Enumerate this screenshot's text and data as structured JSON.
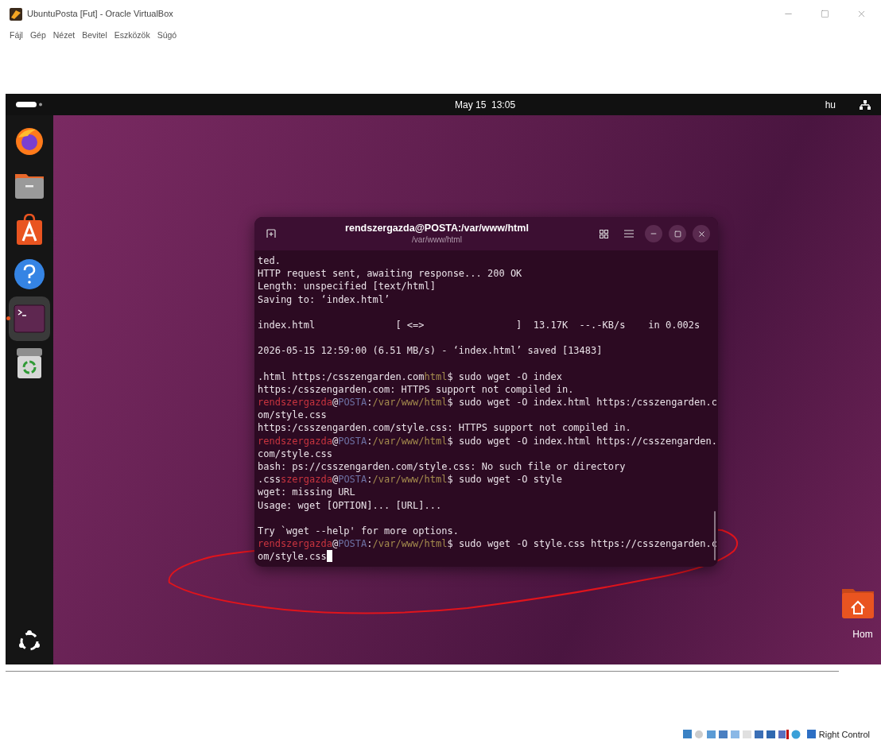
{
  "host_window": {
    "title": "UbuntuPosta [Fut] - Oracle VirtualBox",
    "menu": [
      "Fájl",
      "Gép",
      "Nézet",
      "Bevitel",
      "Eszközök",
      "Súgó"
    ]
  },
  "top_bar": {
    "clock": "May 15  13:05",
    "input_source": "hu"
  },
  "dock": {
    "items": [
      {
        "kind": "browser",
        "selected": false,
        "running": false
      },
      {
        "kind": "files",
        "selected": false,
        "running": false
      },
      {
        "kind": "store",
        "selected": false,
        "running": false
      },
      {
        "kind": "help",
        "selected": false,
        "running": false
      },
      {
        "kind": "terminal",
        "selected": true,
        "running": true
      },
      {
        "kind": "trash",
        "selected": false,
        "running": false
      }
    ]
  },
  "terminal": {
    "title": "rendszergazda@POSTA:/var/www/html",
    "subtitle": "/var/www/html",
    "cursor_visible": true,
    "lines": [
      {
        "kind": "output",
        "segments": [
          {
            "kind": "text",
            "text": "ted."
          }
        ]
      },
      {
        "kind": "output",
        "segments": [
          {
            "kind": "text",
            "text": "HTTP request sent, awaiting response... 200 OK"
          }
        ]
      },
      {
        "kind": "output",
        "segments": [
          {
            "kind": "text",
            "text": "Length: unspecified [text/html]"
          }
        ]
      },
      {
        "kind": "output",
        "segments": [
          {
            "kind": "text",
            "text": "Saving to: ‘index.html’"
          }
        ]
      },
      {
        "kind": "blank"
      },
      {
        "kind": "output",
        "segments": [
          {
            "kind": "text",
            "text": "index.html              [ <=>                ]  13.17K  --.-KB/s    in 0.002s"
          }
        ]
      },
      {
        "kind": "blank"
      },
      {
        "kind": "output",
        "segments": [
          {
            "kind": "text",
            "text": "2026-05-15 12:59:00 (6.51 MB/s) - ‘index.html’ saved [13483]"
          }
        ]
      },
      {
        "kind": "blank"
      },
      {
        "kind": "output",
        "segments": [
          {
            "kind": "text",
            "text": ".html https:/csszengarden.com"
          },
          {
            "kind": "path",
            "text": "html"
          },
          {
            "kind": "text",
            "text": "$ sudo wget -O index"
          }
        ]
      },
      {
        "kind": "output",
        "segments": [
          {
            "kind": "text",
            "text": "https:/csszengarden.com: HTTPS support not compiled in."
          }
        ]
      },
      {
        "kind": "output",
        "segments": [
          {
            "kind": "user",
            "text": "rendszergazda"
          },
          {
            "kind": "text",
            "text": "@"
          },
          {
            "kind": "host",
            "text": "POSTA"
          },
          {
            "kind": "text",
            "text": ":"
          },
          {
            "kind": "path",
            "text": "/var/www/html"
          },
          {
            "kind": "text",
            "text": "$ sudo wget -O index.html https:/csszengarden.c"
          }
        ]
      },
      {
        "kind": "output",
        "segments": [
          {
            "kind": "text",
            "text": "om/style.css"
          }
        ]
      },
      {
        "kind": "output",
        "segments": [
          {
            "kind": "text",
            "text": "https:/csszengarden.com/style.css: HTTPS support not compiled in."
          }
        ]
      },
      {
        "kind": "output",
        "segments": [
          {
            "kind": "user",
            "text": "rendszergazda"
          },
          {
            "kind": "text",
            "text": "@"
          },
          {
            "kind": "host",
            "text": "POSTA"
          },
          {
            "kind": "text",
            "text": ":"
          },
          {
            "kind": "path",
            "text": "/var/www/html"
          },
          {
            "kind": "text",
            "text": "$ sudo wget -O index.html https://csszengarden."
          }
        ]
      },
      {
        "kind": "output",
        "segments": [
          {
            "kind": "text",
            "text": "com/style.css"
          }
        ]
      },
      {
        "kind": "output",
        "segments": [
          {
            "kind": "text",
            "text": "bash: ps://csszengarden.com/style.css: No such file or directory"
          }
        ]
      },
      {
        "kind": "output",
        "segments": [
          {
            "kind": "text",
            "text": ".css"
          },
          {
            "kind": "user",
            "text": "szergazda"
          },
          {
            "kind": "text",
            "text": "@"
          },
          {
            "kind": "host",
            "text": "POSTA"
          },
          {
            "kind": "text",
            "text": ":"
          },
          {
            "kind": "path",
            "text": "/var/www/html"
          },
          {
            "kind": "text",
            "text": "$ sudo wget -O style"
          }
        ]
      },
      {
        "kind": "output",
        "segments": [
          {
            "kind": "text",
            "text": "wget: missing URL"
          }
        ]
      },
      {
        "kind": "output",
        "segments": [
          {
            "kind": "text",
            "text": "Usage: wget [OPTION]... [URL]..."
          }
        ]
      },
      {
        "kind": "blank"
      },
      {
        "kind": "output",
        "segments": [
          {
            "kind": "text",
            "text": "Try `wget --help' for more options."
          }
        ]
      },
      {
        "kind": "output",
        "segments": [
          {
            "kind": "user",
            "text": "rendszergazda"
          },
          {
            "kind": "text",
            "text": "@"
          },
          {
            "kind": "host",
            "text": "POSTA"
          },
          {
            "kind": "text",
            "text": ":"
          },
          {
            "kind": "path",
            "text": "/var/www/html"
          },
          {
            "kind": "text",
            "text": "$ sudo wget -O style.css https://csszengarden.c"
          }
        ]
      },
      {
        "kind": "output",
        "segments": [
          {
            "kind": "text",
            "text": "om/style.css"
          }
        ]
      }
    ]
  },
  "desktop": {
    "icons": [
      {
        "label": "Hom"
      }
    ]
  },
  "status_bar": {
    "host_key": "Right Control"
  }
}
